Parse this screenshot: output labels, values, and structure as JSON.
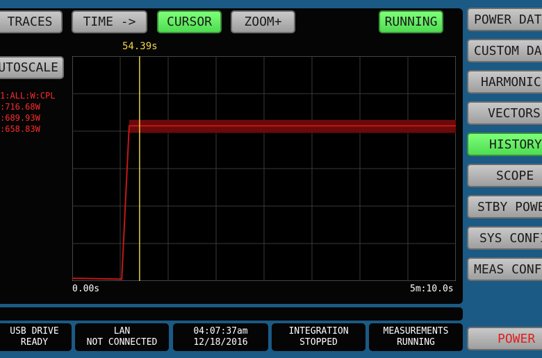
{
  "toolbar": {
    "traces": "TRACES",
    "time": "TIME ->",
    "cursor": "CURSOR",
    "zoom": "ZOOM+",
    "running": "RUNNING"
  },
  "autoscale": "AUTOSCALE",
  "cursor": {
    "time_label": "54.39s"
  },
  "readouts": [
    "1:ALL:W:CPL",
    ":716.68W",
    ":689.93W",
    ":658.83W"
  ],
  "plot": {
    "x_start_label": "0.00s",
    "x_end_label": "5m:10.0s"
  },
  "sidebar": {
    "items": [
      {
        "label": "POWER DATA",
        "active": false
      },
      {
        "label": "CUSTOM DATA",
        "active": false
      },
      {
        "label": "HARMONICS",
        "active": false
      },
      {
        "label": "VECTORS",
        "active": false
      },
      {
        "label": "HISTORY",
        "active": true
      },
      {
        "label": "SCOPE",
        "active": false
      },
      {
        "label": "STBY POWER",
        "active": false
      },
      {
        "label": "SYS CONFIG",
        "active": false
      },
      {
        "label": "MEAS CONFIG",
        "active": false
      }
    ],
    "power": "POWER"
  },
  "status_bar": [
    {
      "line1": "USB DRIVE",
      "line2": "READY"
    },
    {
      "line1": "LAN",
      "line2": "NOT CONNECTED"
    },
    {
      "line1": "04:07:37am",
      "line2": "12/18/2016"
    },
    {
      "line1": "INTEGRATION",
      "line2": "STOPPED"
    },
    {
      "line1": "MEASUREMENTS",
      "line2": "RUNNING"
    }
  ],
  "colors": {
    "background": "#1a5a85",
    "panel": "#050505",
    "active_button": "#5ee85c",
    "trace": "#c41818",
    "cursor_line": "#e8d24a",
    "readout_text": "#ff2a2a"
  },
  "chart_data": {
    "type": "line",
    "x_range": [
      "0.00s",
      "5m:10.0s"
    ],
    "cursor_x": "54.39s",
    "grid": true,
    "series": [
      {
        "values_description_points": [
          {
            "t_s": 0,
            "w": 12
          },
          {
            "t_s": 40,
            "w": 8
          },
          {
            "t_s": 46,
            "w": 690
          },
          {
            "t_s": 310,
            "w": 690
          }
        ],
        "band_w": [
          658.83,
          716.68
        ]
      }
    ]
  }
}
